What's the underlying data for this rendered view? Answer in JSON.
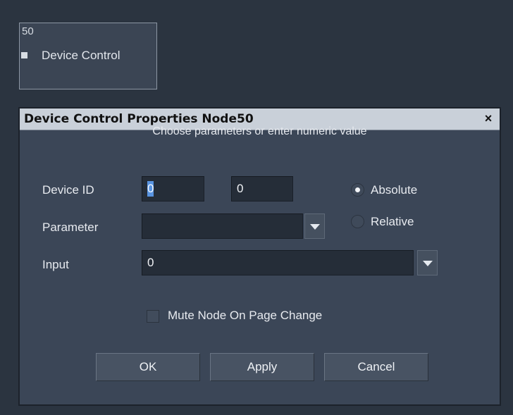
{
  "node": {
    "id": "50",
    "title": "Device Control"
  },
  "dialog": {
    "title": "Device Control Properties Node50",
    "close_label": "×",
    "subtitle": "Choose parameters or enter numeric value",
    "device_id_label": "Device ID",
    "device_id_value_1": "0",
    "device_id_value_2": "0",
    "parameter_label": "Parameter",
    "parameter_value": "",
    "input_label": "Input",
    "input_value": "0",
    "mode": {
      "absolute_label": "Absolute",
      "relative_label": "Relative",
      "selected": "Absolute"
    },
    "mute_label": "Mute Node On Page Change",
    "mute_checked": false,
    "buttons": {
      "ok": "OK",
      "apply": "Apply",
      "cancel": "Cancel"
    }
  }
}
